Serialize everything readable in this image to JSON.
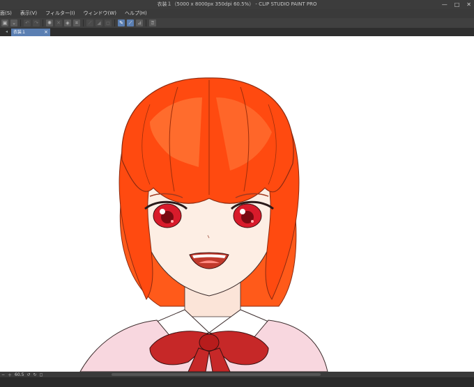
{
  "window": {
    "title": "衣装１（5000 x 8000px 350dpi 60.5%） - CLIP STUDIO PAINT PRO",
    "minimize_glyph": "—",
    "maximize_glyph": "□",
    "close_glyph": "✕"
  },
  "menu": {
    "items": [
      "面(S)",
      "表示(V)",
      "フィルター(I)",
      "ウィンドウ(W)",
      "ヘルプ(H)"
    ]
  },
  "toolbar": {
    "buttons": [
      {
        "icon": "save-icon",
        "glyph": "▣",
        "state": "normal"
      },
      {
        "icon": "dropdown-icon",
        "glyph": "⌄",
        "state": "normal"
      },
      {
        "icon": "undo-icon",
        "glyph": "↶",
        "state": "dim"
      },
      {
        "icon": "redo-icon",
        "glyph": "↷",
        "state": "dim"
      },
      {
        "icon": "loading-icon",
        "glyph": "✺",
        "state": "normal"
      },
      {
        "icon": "clear-icon",
        "glyph": "✕",
        "state": "dim"
      },
      {
        "icon": "fill-icon",
        "glyph": "◈",
        "state": "normal"
      },
      {
        "icon": "crop-icon",
        "glyph": "⌗",
        "state": "normal"
      },
      {
        "icon": "transform-icon",
        "glyph": "⟋",
        "state": "dim"
      },
      {
        "icon": "flip-icon",
        "glyph": "◢",
        "state": "dim"
      },
      {
        "icon": "square-icon",
        "glyph": "◻",
        "state": "dim"
      },
      {
        "icon": "pen-icon",
        "glyph": "✎",
        "state": "active"
      },
      {
        "icon": "line-icon",
        "glyph": "⟋",
        "state": "active"
      },
      {
        "icon": "ruler-icon",
        "glyph": "⊿",
        "state": "normal"
      },
      {
        "icon": "reference-icon",
        "glyph": "⍰",
        "state": "normal"
      }
    ]
  },
  "tabs": {
    "active_label": "衣装１",
    "close_glyph": "×",
    "scroll_glyph": "◂"
  },
  "status": {
    "zoom": "60.5",
    "icons": [
      "minus-icon",
      "plus-icon",
      "rotate-left-icon",
      "rotate-right-icon",
      "fit-icon"
    ]
  },
  "colors": {
    "hair": "#ff4a10",
    "hair_light": "#ff7a3a",
    "skin": "#fdeee4",
    "eye": "#d81b2b",
    "bow": "#c62828",
    "shirt": "#f8d7df",
    "accent": "#5b7fb2"
  }
}
